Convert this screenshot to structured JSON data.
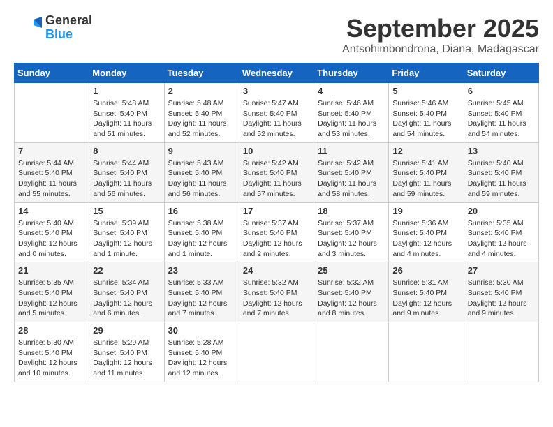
{
  "header": {
    "logo": {
      "general": "General",
      "blue": "Blue"
    },
    "title": "September 2025",
    "location": "Antsohimbondrona, Diana, Madagascar"
  },
  "calendar": {
    "headers": [
      "Sunday",
      "Monday",
      "Tuesday",
      "Wednesday",
      "Thursday",
      "Friday",
      "Saturday"
    ],
    "weeks": [
      [
        {
          "day": "",
          "info": ""
        },
        {
          "day": "1",
          "info": "Sunrise: 5:48 AM\nSunset: 5:40 PM\nDaylight: 11 hours\nand 51 minutes."
        },
        {
          "day": "2",
          "info": "Sunrise: 5:48 AM\nSunset: 5:40 PM\nDaylight: 11 hours\nand 52 minutes."
        },
        {
          "day": "3",
          "info": "Sunrise: 5:47 AM\nSunset: 5:40 PM\nDaylight: 11 hours\nand 52 minutes."
        },
        {
          "day": "4",
          "info": "Sunrise: 5:46 AM\nSunset: 5:40 PM\nDaylight: 11 hours\nand 53 minutes."
        },
        {
          "day": "5",
          "info": "Sunrise: 5:46 AM\nSunset: 5:40 PM\nDaylight: 11 hours\nand 54 minutes."
        },
        {
          "day": "6",
          "info": "Sunrise: 5:45 AM\nSunset: 5:40 PM\nDaylight: 11 hours\nand 54 minutes."
        }
      ],
      [
        {
          "day": "7",
          "info": "Sunrise: 5:44 AM\nSunset: 5:40 PM\nDaylight: 11 hours\nand 55 minutes."
        },
        {
          "day": "8",
          "info": "Sunrise: 5:44 AM\nSunset: 5:40 PM\nDaylight: 11 hours\nand 56 minutes."
        },
        {
          "day": "9",
          "info": "Sunrise: 5:43 AM\nSunset: 5:40 PM\nDaylight: 11 hours\nand 56 minutes."
        },
        {
          "day": "10",
          "info": "Sunrise: 5:42 AM\nSunset: 5:40 PM\nDaylight: 11 hours\nand 57 minutes."
        },
        {
          "day": "11",
          "info": "Sunrise: 5:42 AM\nSunset: 5:40 PM\nDaylight: 11 hours\nand 58 minutes."
        },
        {
          "day": "12",
          "info": "Sunrise: 5:41 AM\nSunset: 5:40 PM\nDaylight: 11 hours\nand 59 minutes."
        },
        {
          "day": "13",
          "info": "Sunrise: 5:40 AM\nSunset: 5:40 PM\nDaylight: 11 hours\nand 59 minutes."
        }
      ],
      [
        {
          "day": "14",
          "info": "Sunrise: 5:40 AM\nSunset: 5:40 PM\nDaylight: 12 hours\nand 0 minutes."
        },
        {
          "day": "15",
          "info": "Sunrise: 5:39 AM\nSunset: 5:40 PM\nDaylight: 12 hours\nand 1 minute."
        },
        {
          "day": "16",
          "info": "Sunrise: 5:38 AM\nSunset: 5:40 PM\nDaylight: 12 hours\nand 1 minute."
        },
        {
          "day": "17",
          "info": "Sunrise: 5:37 AM\nSunset: 5:40 PM\nDaylight: 12 hours\nand 2 minutes."
        },
        {
          "day": "18",
          "info": "Sunrise: 5:37 AM\nSunset: 5:40 PM\nDaylight: 12 hours\nand 3 minutes."
        },
        {
          "day": "19",
          "info": "Sunrise: 5:36 AM\nSunset: 5:40 PM\nDaylight: 12 hours\nand 4 minutes."
        },
        {
          "day": "20",
          "info": "Sunrise: 5:35 AM\nSunset: 5:40 PM\nDaylight: 12 hours\nand 4 minutes."
        }
      ],
      [
        {
          "day": "21",
          "info": "Sunrise: 5:35 AM\nSunset: 5:40 PM\nDaylight: 12 hours\nand 5 minutes."
        },
        {
          "day": "22",
          "info": "Sunrise: 5:34 AM\nSunset: 5:40 PM\nDaylight: 12 hours\nand 6 minutes."
        },
        {
          "day": "23",
          "info": "Sunrise: 5:33 AM\nSunset: 5:40 PM\nDaylight: 12 hours\nand 7 minutes."
        },
        {
          "day": "24",
          "info": "Sunrise: 5:32 AM\nSunset: 5:40 PM\nDaylight: 12 hours\nand 7 minutes."
        },
        {
          "day": "25",
          "info": "Sunrise: 5:32 AM\nSunset: 5:40 PM\nDaylight: 12 hours\nand 8 minutes."
        },
        {
          "day": "26",
          "info": "Sunrise: 5:31 AM\nSunset: 5:40 PM\nDaylight: 12 hours\nand 9 minutes."
        },
        {
          "day": "27",
          "info": "Sunrise: 5:30 AM\nSunset: 5:40 PM\nDaylight: 12 hours\nand 9 minutes."
        }
      ],
      [
        {
          "day": "28",
          "info": "Sunrise: 5:30 AM\nSunset: 5:40 PM\nDaylight: 12 hours\nand 10 minutes."
        },
        {
          "day": "29",
          "info": "Sunrise: 5:29 AM\nSunset: 5:40 PM\nDaylight: 12 hours\nand 11 minutes."
        },
        {
          "day": "30",
          "info": "Sunrise: 5:28 AM\nSunset: 5:40 PM\nDaylight: 12 hours\nand 12 minutes."
        },
        {
          "day": "",
          "info": ""
        },
        {
          "day": "",
          "info": ""
        },
        {
          "day": "",
          "info": ""
        },
        {
          "day": "",
          "info": ""
        }
      ]
    ]
  }
}
